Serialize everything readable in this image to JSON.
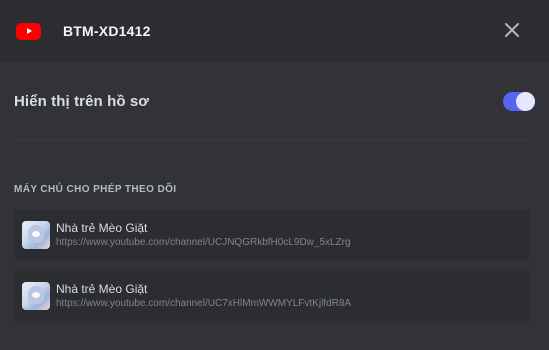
{
  "header": {
    "title": "BTM-XD1412",
    "brand_icon": "youtube-icon",
    "close_icon": "close-icon"
  },
  "toggle_row": {
    "label": "Hiển thị trên hồ sơ",
    "enabled": true
  },
  "section": {
    "title": "MÁY CHỦ CHO PHÉP THEO DÕI"
  },
  "servers": [
    {
      "name": "Nhà trẻ Mèo Giặt",
      "url": "https://www.youtube.com/channel/UCJNQGRkbfH0cL9Dw_5xLZrg",
      "icon": "server-avatar"
    },
    {
      "name": "Nhà trẻ Mèo Giặt",
      "url": "https://www.youtube.com/channel/UC7xHlMmWWMYLFvtKjlfdR8A",
      "icon": "server-avatar"
    }
  ],
  "colors": {
    "background": "#313338",
    "header_bg": "#2b2d31",
    "accent": "#5865f2",
    "youtube_red": "#ff0000",
    "text_primary": "#dbdee1",
    "text_muted": "#80848e"
  }
}
